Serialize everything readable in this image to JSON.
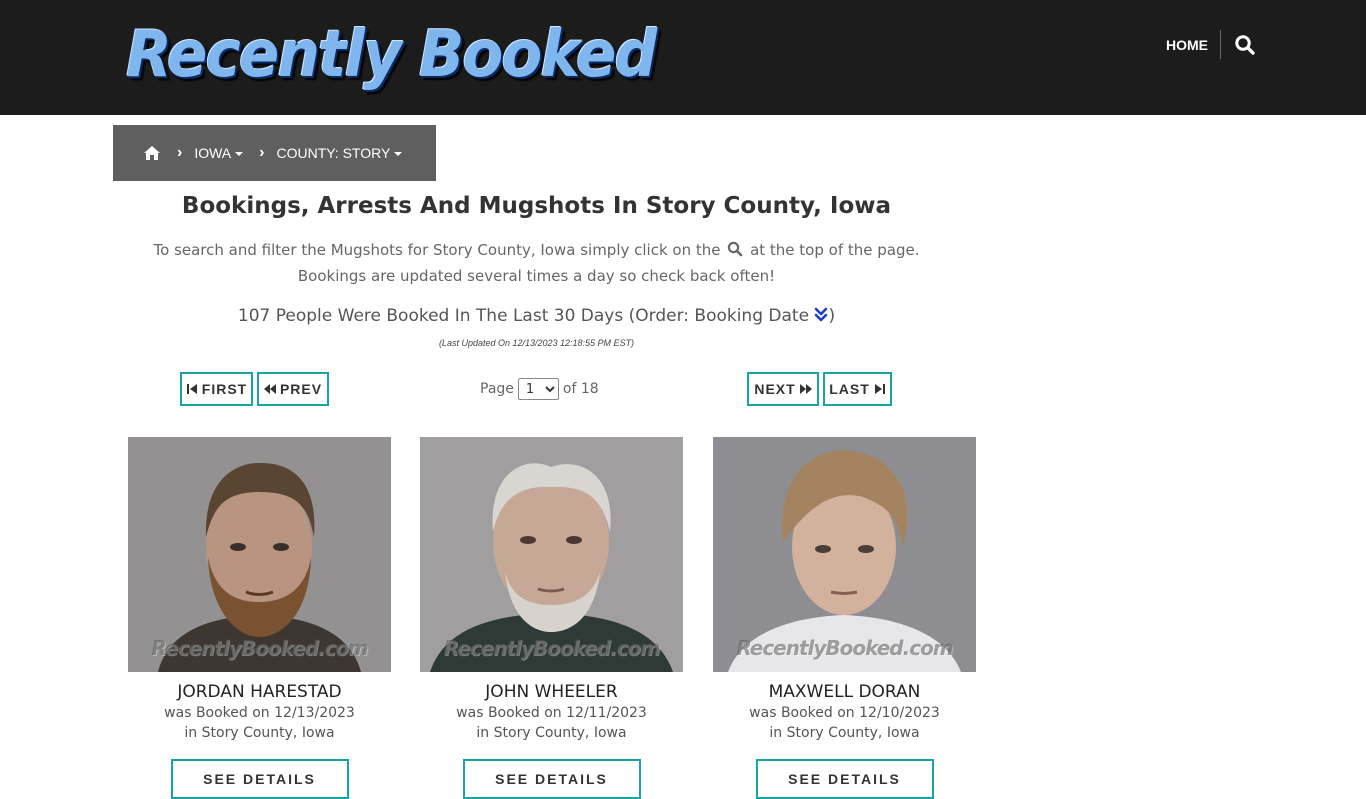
{
  "header": {
    "logo_text": "Recently Booked",
    "nav_home": "HOME",
    "search_icon": "search-icon"
  },
  "breadcrumb": {
    "home_icon": "home-icon",
    "items": [
      {
        "label": "IOWA"
      },
      {
        "label": "COUNTY: STORY"
      }
    ]
  },
  "main": {
    "title": "Bookings, Arrests And Mugshots In Story County, Iowa",
    "intro_before": "To search and filter the Mugshots for Story County, Iowa simply click on the",
    "intro_after": "at the top of the page. Bookings are updated several times a day so check back often!",
    "count_text": "107 People Were Booked In The Last 30 Days (Order: Booking Date",
    "count_close": ")",
    "last_updated": "(Last Updated On 12/13/2023 12:18:55 PM EST)"
  },
  "pagination": {
    "first": "FIRST",
    "prev": "PREV",
    "next": "NEXT",
    "last": "LAST",
    "page_label": "Page",
    "current_page": "1",
    "of_label": "of 18"
  },
  "bookings": [
    {
      "name": "JORDAN HARESTAD",
      "desc": "was Booked on 12/13/2023 in Story County, Iowa",
      "button": "SEE DETAILS",
      "watermark": "RecentlyBooked.com"
    },
    {
      "name": "JOHN WHEELER",
      "desc": "was Booked on 12/11/2023 in Story County, Iowa",
      "button": "SEE DETAILS",
      "watermark": "RecentlyBooked.com"
    },
    {
      "name": "MAXWELL DORAN",
      "desc": "was Booked on 12/10/2023 in Story County, Iowa",
      "button": "SEE DETAILS",
      "watermark": "RecentlyBooked.com"
    }
  ],
  "colors": {
    "header_bg": "#1c1c1c",
    "breadcrumb_bg": "#5f5f5f",
    "accent_border": "#1aa3a3",
    "order_icon": "#1a3fc4"
  }
}
